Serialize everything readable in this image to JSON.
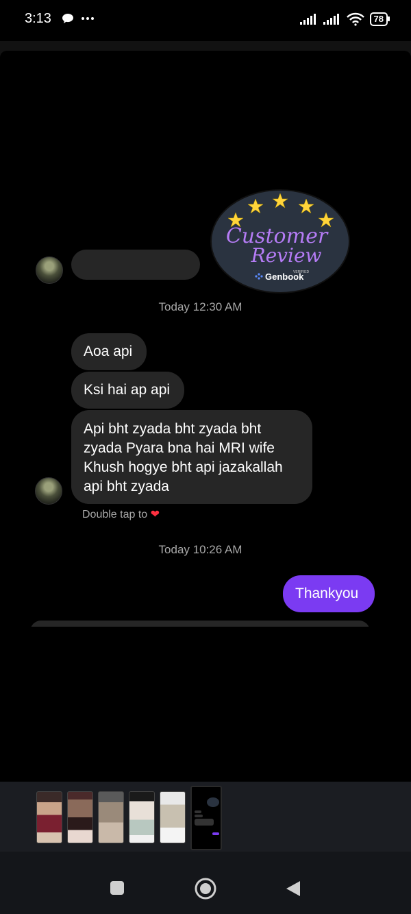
{
  "status_bar": {
    "time": "3:13",
    "battery": "78",
    "icons": [
      "chat-bubble-icon",
      "more-dots-icon",
      "signal-icon",
      "signal-icon",
      "wifi-icon",
      "battery-icon"
    ]
  },
  "sticker": {
    "line1": "Customer",
    "line2": "Review",
    "brand": "Genbook",
    "badge": "VERIFIED",
    "stars": 5
  },
  "chat": {
    "timestamps": [
      "Today 12:30 AM",
      "Today 10:26 AM"
    ],
    "incoming": [
      "Aoa api",
      "Ksi hai ap api",
      "Api bht zyada bht zyada bht zyada Pyara bna hai MRI wife Khush hogye bht api jazakallah api bht zyada"
    ],
    "double_tap": "Double tap to",
    "outgoing": [
      "Thankyou"
    ]
  },
  "tray": {
    "thumbnail_count": 6,
    "selected_index": 5
  },
  "nav": {
    "buttons": [
      "recents-square-icon",
      "home-circle-icon",
      "back-triangle-icon"
    ]
  },
  "colors": {
    "outgoing_bubble": "#7b3bf2",
    "incoming_bubble": "#262626",
    "background": "#000000",
    "heart": "#ff3040"
  }
}
